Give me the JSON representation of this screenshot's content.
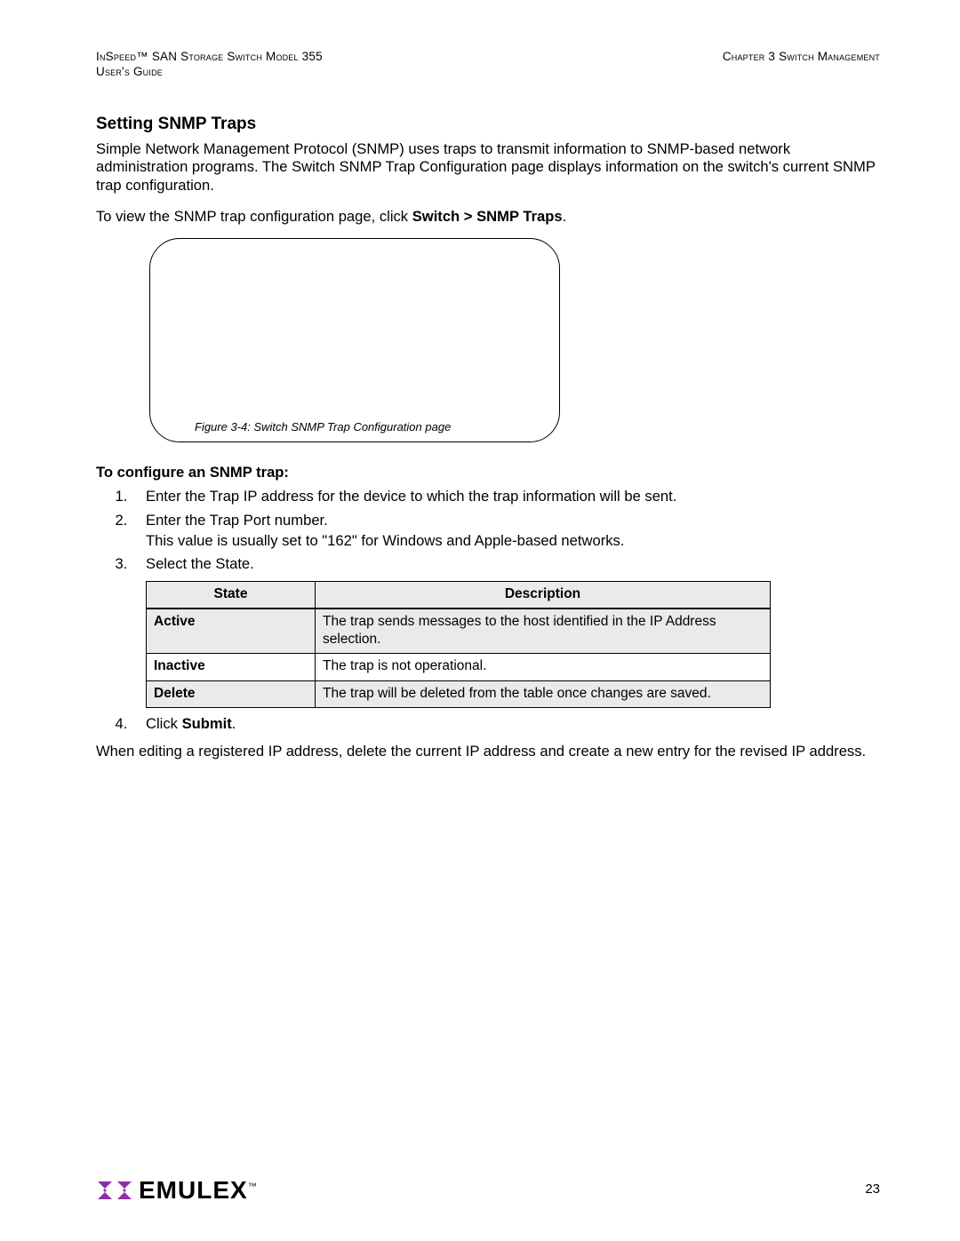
{
  "header": {
    "left": "InSpeed™ SAN Storage Switch Model 355\nUser's Guide",
    "right": "Chapter 3 Switch Management"
  },
  "title": "Setting SNMP Traps",
  "para1": "Simple Network Management Protocol (SNMP) uses traps to transmit information to SNMP-based network administration programs. The Switch SNMP Trap Configuration page displays information on the switch's current SNMP trap configuration.",
  "para2_pre": "To view the SNMP trap configuration page, click ",
  "para2_bold": "Switch > SNMP Traps",
  "para2_post": ".",
  "figcaption": "Figure 3-4: Switch SNMP Trap Configuration page",
  "subhead": "To configure an SNMP trap:",
  "steps": [
    {
      "n": "1",
      "text": "Enter the Trap IP address for the device to which the trap information will be sent."
    },
    {
      "n": "2",
      "text": "Enter the Trap Port number.",
      "cont": "This value is usually set to \"162\" for Windows and Apple-based networks."
    },
    {
      "n": "3",
      "text": "Select the State."
    }
  ],
  "table": {
    "head": [
      "State",
      "Description"
    ],
    "rows": [
      [
        "Active",
        "The trap sends messages to the host identified in the IP Address selection."
      ],
      [
        "Inactive",
        "The trap is not operational."
      ],
      [
        "Delete",
        "The trap will be deleted from the table once changes are saved."
      ]
    ]
  },
  "step4_pre": "Click ",
  "step4_bold": "Submit",
  "step4_post": ".",
  "closing": "When editing a registered IP address, delete the current IP address and create a new entry for the revised IP address.",
  "logo_text": "EMULEX",
  "pagenum": "23"
}
